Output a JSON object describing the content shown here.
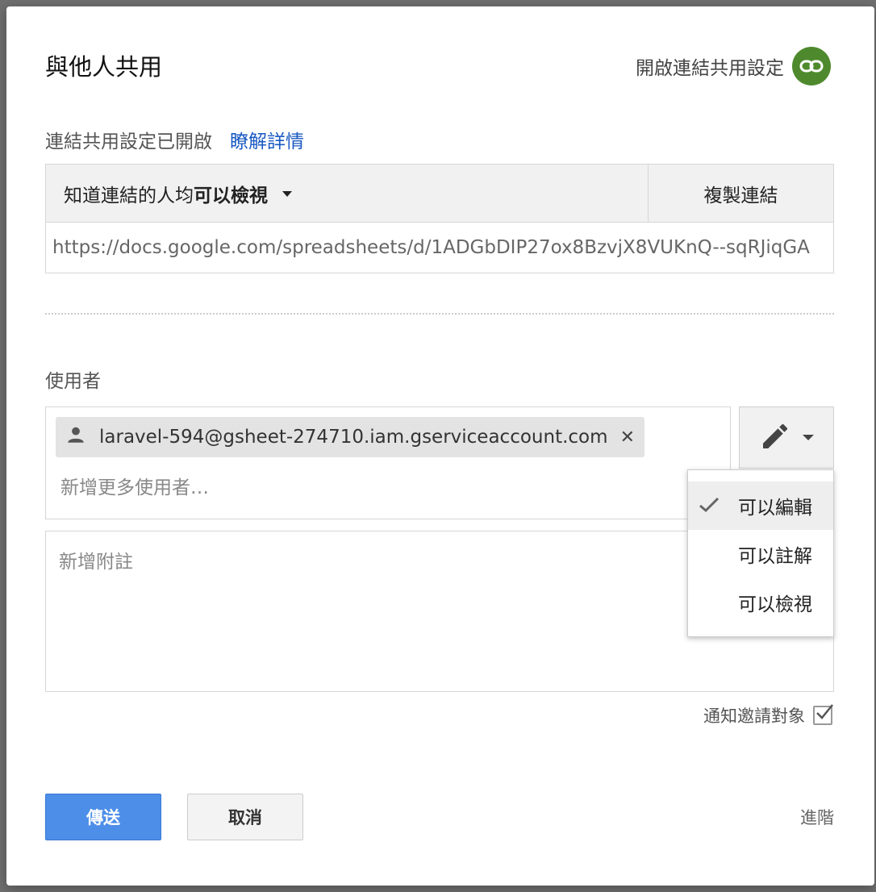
{
  "dialog": {
    "title": "與他人共用",
    "link_sharing_toggle_label": "開啟連結共用設定",
    "link_sharing_icon": "link-icon",
    "link_sharing_color": "#4e8a2d"
  },
  "link_sharing": {
    "status_text": "連結共用設定已開啟",
    "learn_more": "瞭解詳情",
    "access_prefix": "知道連結的人均",
    "access_level": "可以檢視",
    "copy_link": "複製連結",
    "url": "https://docs.google.com/spreadsheets/d/1ADGbDIP27ox8BzvjX8VUKnQ--sqRJiqGA"
  },
  "people": {
    "label": "使用者",
    "chips": [
      {
        "email": "laravel-594@gsheet-274710.iam.gserviceaccount.com",
        "icon": "person-icon",
        "remove_icon": "close-icon"
      }
    ],
    "add_more_placeholder": "新增更多使用者…",
    "permission_icon": "pencil-icon"
  },
  "permission_menu": {
    "items": [
      {
        "label": "可以編輯",
        "selected": true
      },
      {
        "label": "可以註解",
        "selected": false
      },
      {
        "label": "可以檢視",
        "selected": false
      }
    ]
  },
  "note": {
    "placeholder": "新增附註"
  },
  "notify": {
    "label": "通知邀請對象",
    "checked": true
  },
  "actions": {
    "send": "傳送",
    "cancel": "取消",
    "advanced": "進階",
    "send_color": "#4d8ee8"
  }
}
